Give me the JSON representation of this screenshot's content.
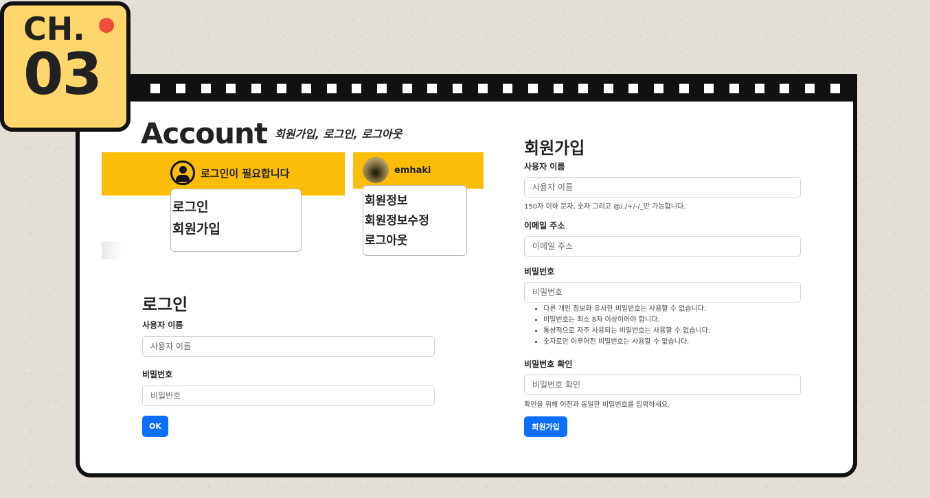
{
  "badge": {
    "chapter": "CH.",
    "number": "03"
  },
  "header": {
    "title": "Account",
    "subtitle": "회원가입, 로그인, 로그아웃"
  },
  "nav_logged_out": {
    "message": "로그인이 필요합니다",
    "items": [
      "로그인",
      "회원가입"
    ]
  },
  "nav_logged_in": {
    "username": "emhaki",
    "items": [
      "회원정보",
      "회원정보수정",
      "로그아웃"
    ]
  },
  "login_form": {
    "title": "로그인",
    "username_label": "사용자 이름",
    "username_placeholder": "사용자 이름",
    "password_label": "비밀번호",
    "password_placeholder": "비밀번호",
    "submit_label": "OK"
  },
  "signup_form": {
    "title": "회원가입",
    "username_label": "사용자 이름",
    "username_placeholder": "사용자 이름",
    "username_help": "150자 이하 문자, 숫자 그리고 @/./+/-/_만 가능합니다.",
    "email_label": "이메일 주소",
    "email_placeholder": "이메일 주소",
    "password_label": "비밀번호",
    "password_placeholder": "비밀번호",
    "password_rules": [
      "다른 개인 정보와 유사한 비밀번호는 사용할 수 없습니다.",
      "비밀번호는 최소 8자 이상이어야 합니다.",
      "통상적으로 자주 사용되는 비밀번호는 사용할 수 없습니다.",
      "숫자로만 이루어진 비밀번호는 사용할 수 없습니다."
    ],
    "password_confirm_label": "비밀번호 확인",
    "password_confirm_placeholder": "비밀번호 확인",
    "password_confirm_help": "확인을 위해 이전과 동일한 비밀번호를 입력하세요.",
    "submit_label": "회원가입"
  },
  "colors": {
    "accent": "#fbbd08",
    "primary": "#0d6efd",
    "badge": "#ffd66b",
    "badge_dot": "#f04d3a"
  }
}
